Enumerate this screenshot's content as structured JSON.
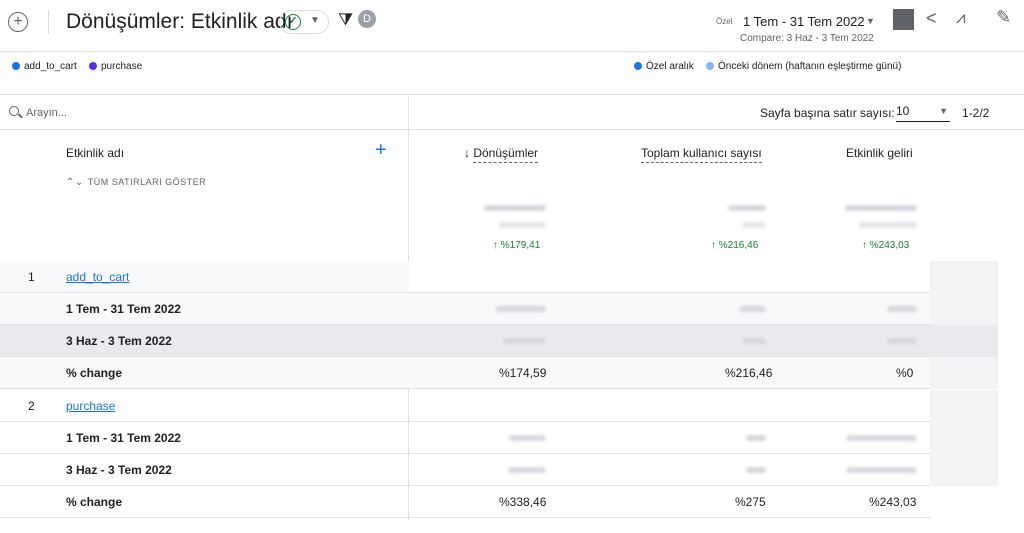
{
  "header": {
    "title": "Dönüşümler: Etkinlik adı",
    "avatar_letter": "D",
    "date_custom_label": "Özel",
    "date_range": "1 Tem - 31 Tem 2022",
    "date_compare": "Compare: 3 Haz - 3 Tem 2022"
  },
  "legend": {
    "series": [
      "add_to_cart",
      "purchase"
    ],
    "periods": [
      "Özel aralık",
      "Önceki dönem (haftanın eşleştirme günü)"
    ],
    "colors": {
      "add_to_cart": "#1a73e8",
      "purchase": "#5c2ee8",
      "custom": "#1a73e8",
      "previous": "#8ab4f8"
    }
  },
  "table": {
    "search_placeholder": "Arayın...",
    "rows_per_page_label": "Sayfa başına satır sayısı:",
    "rows_per_page_value": "10",
    "page_count": "1-2/2",
    "dimension_header": "Etkinlik adı",
    "show_all_rows": "TÜM SATIRLARI GÖSTER",
    "metric_headers": [
      "Dönüşümler",
      "Toplam kullanıcı sayısı",
      "Etkinlik geliri"
    ],
    "sort_arrow": "↓",
    "totals_change": [
      "↑ %179,41",
      "↑ %216,46",
      "↑ %243,03"
    ],
    "groups": [
      {
        "index": "1",
        "name": "add_to_cart",
        "period1": "1 Tem - 31 Tem 2022",
        "period2": "3 Haz - 3 Tem 2022",
        "change_label": "% change",
        "changes": [
          "%174,59",
          "%216,46",
          "%0"
        ]
      },
      {
        "index": "2",
        "name": "purchase",
        "period1": "1 Tem - 31 Tem 2022",
        "period2": "3 Haz - 3 Tem 2022",
        "change_label": "% change",
        "changes": [
          "%338,46",
          "%275",
          "%243,03"
        ]
      }
    ]
  }
}
